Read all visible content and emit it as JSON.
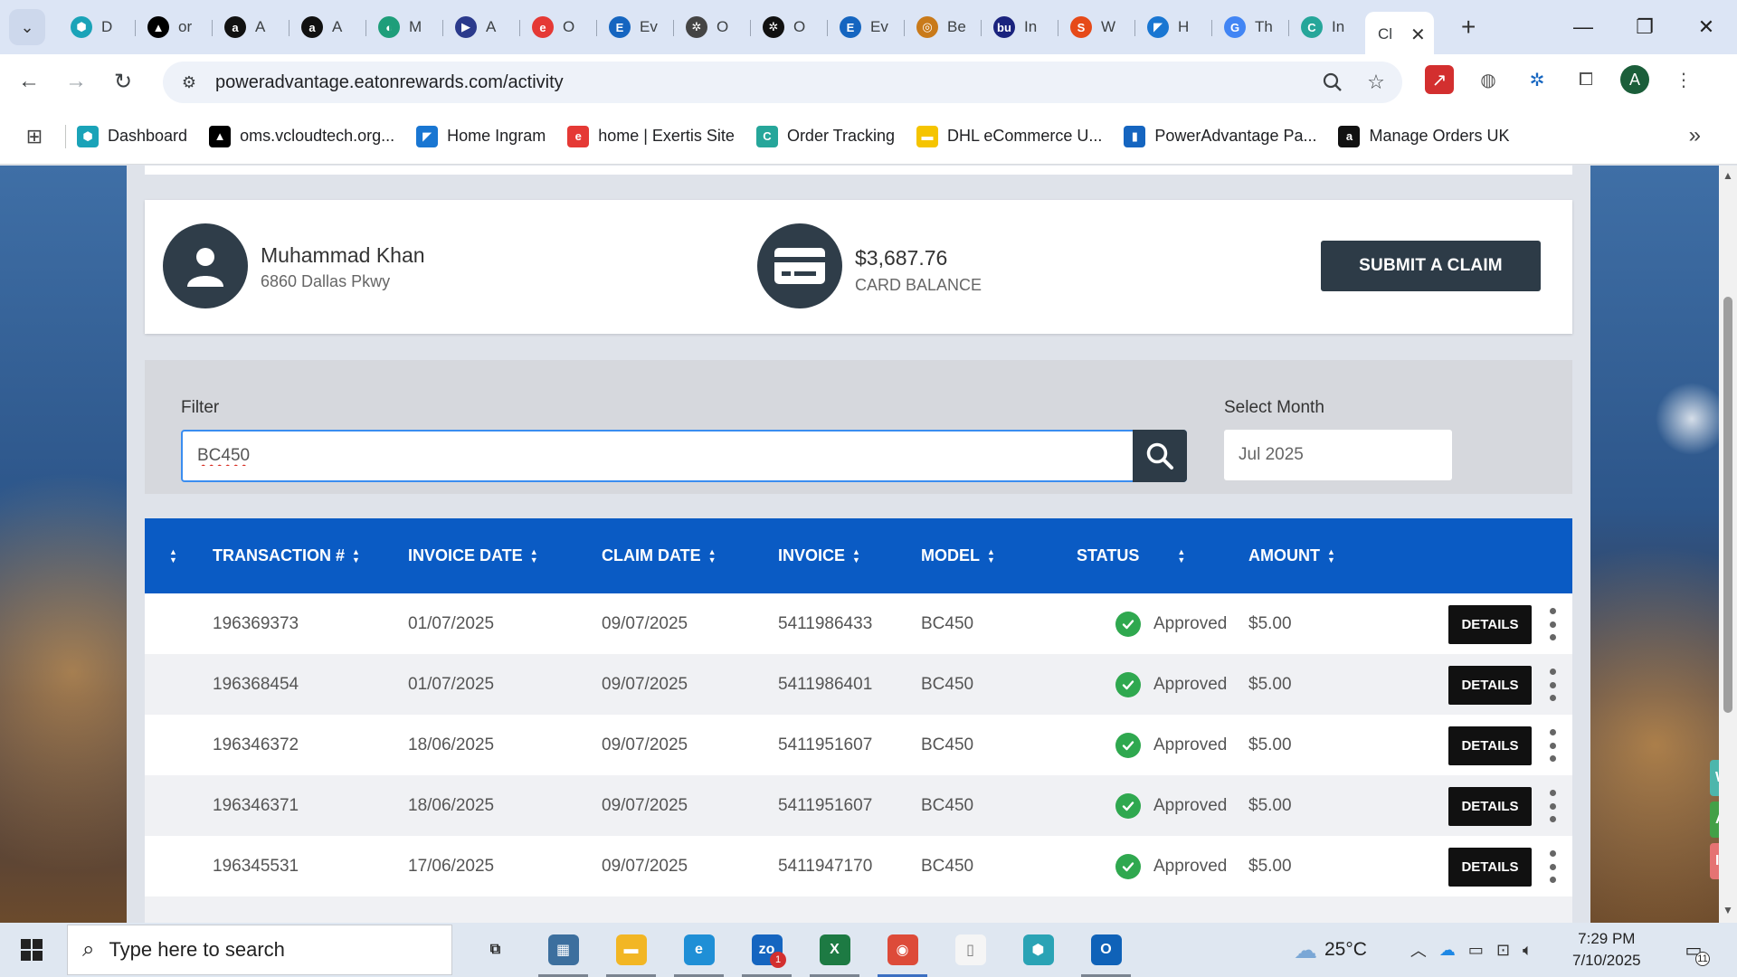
{
  "browser": {
    "tabs": [
      {
        "short": "D",
        "favicon": "hexagon-icon",
        "color": "#1aa3b8",
        "glyph": "⬢"
      },
      {
        "short": "or",
        "favicon": "triangle-icon",
        "color": "#000000",
        "glyph": "▲"
      },
      {
        "short": "A",
        "favicon": "amazon-icon",
        "color": "#111111",
        "glyph": "a"
      },
      {
        "short": "A",
        "favicon": "amazon-icon",
        "color": "#111111",
        "glyph": "a"
      },
      {
        "short": "M",
        "favicon": "leaf-icon",
        "color": "#1e9e7a",
        "glyph": "◐"
      },
      {
        "short": "A",
        "favicon": "arrow-icon",
        "color": "#2b3a8c",
        "glyph": "▶"
      },
      {
        "short": "O",
        "favicon": "exertis-icon",
        "color": "#e53935",
        "glyph": "e"
      },
      {
        "short": "Ev",
        "favicon": "e-icon",
        "color": "#1565c0",
        "glyph": "E"
      },
      {
        "short": "O",
        "favicon": "openai-icon",
        "color": "#444444",
        "glyph": "✲"
      },
      {
        "short": "O",
        "favicon": "openai-icon",
        "color": "#111111",
        "glyph": "✲"
      },
      {
        "short": "Ev",
        "favicon": "e-icon",
        "color": "#1565c0",
        "glyph": "E"
      },
      {
        "short": "Be",
        "favicon": "bulb-icon",
        "color": "#c97a1a",
        "glyph": "◎"
      },
      {
        "short": "In",
        "favicon": "bu-icon",
        "color": "#1a237e",
        "glyph": "bu"
      },
      {
        "short": "W",
        "favicon": "layers-icon",
        "color": "#e64a19",
        "glyph": "S"
      },
      {
        "short": "H",
        "favicon": "ingram-icon",
        "color": "#1976d2",
        "glyph": "◤"
      },
      {
        "short": "Th",
        "favicon": "google-icon",
        "color": "#4285f4",
        "glyph": "G"
      },
      {
        "short": "In",
        "favicon": "c-icon",
        "color": "#26a69a",
        "glyph": "C"
      }
    ],
    "active_tab_short": "Cl",
    "url": "poweradvantage.eatonrewards.com/activity",
    "bookmarks": [
      {
        "label": "Dashboard",
        "favicon": "hexagon-icon",
        "color": "#1aa3b8",
        "glyph": "⬢"
      },
      {
        "label": "oms.vcloudtech.org...",
        "favicon": "triangle-icon",
        "color": "#000000",
        "glyph": "▲"
      },
      {
        "label": "Home Ingram",
        "favicon": "ingram-icon",
        "color": "#1976d2",
        "glyph": "◤"
      },
      {
        "label": "home | Exertis Site",
        "favicon": "exertis-icon",
        "color": "#e53935",
        "glyph": "e"
      },
      {
        "label": "Order Tracking",
        "favicon": "c-icon",
        "color": "#26a69a",
        "glyph": "C"
      },
      {
        "label": "DHL eCommerce U...",
        "favicon": "dhl-icon",
        "color": "#f5c400",
        "glyph": "▬"
      },
      {
        "label": "PowerAdvantage Pa...",
        "favicon": "doc-icon",
        "color": "#1565c0",
        "glyph": "▮"
      },
      {
        "label": "Manage Orders UK",
        "favicon": "amazon-icon",
        "color": "#111111",
        "glyph": "a"
      }
    ],
    "profile_initial": "A"
  },
  "profile": {
    "name": "Muhammad Khan",
    "address": "6860 Dallas Pkwy",
    "balance": "$3,687.76",
    "balance_label": "CARD BALANCE",
    "submit_label": "SUBMIT A CLAIM"
  },
  "filter": {
    "label": "Filter",
    "value": "BC450",
    "month_label": "Select Month",
    "month_value": "Jul 2025"
  },
  "table": {
    "columns": [
      "TRANSACTION #",
      "INVOICE DATE",
      "CLAIM DATE",
      "INVOICE",
      "MODEL",
      "STATUS",
      "AMOUNT"
    ],
    "details_label": "DETAILS",
    "rows": [
      {
        "transaction": "196369373",
        "invoice_date": "01/07/2025",
        "claim_date": "09/07/2025",
        "invoice": "5411986433",
        "model": "BC450",
        "status": "Approved",
        "amount": "$5.00"
      },
      {
        "transaction": "196368454",
        "invoice_date": "01/07/2025",
        "claim_date": "09/07/2025",
        "invoice": "5411986401",
        "model": "BC450",
        "status": "Approved",
        "amount": "$5.00"
      },
      {
        "transaction": "196346372",
        "invoice_date": "18/06/2025",
        "claim_date": "09/07/2025",
        "invoice": "5411951607",
        "model": "BC450",
        "status": "Approved",
        "amount": "$5.00"
      },
      {
        "transaction": "196346371",
        "invoice_date": "18/06/2025",
        "claim_date": "09/07/2025",
        "invoice": "5411951607",
        "model": "BC450",
        "status": "Approved",
        "amount": "$5.00"
      },
      {
        "transaction": "196345531",
        "invoice_date": "17/06/2025",
        "claim_date": "09/07/2025",
        "invoice": "5411947170",
        "model": "BC450",
        "status": "Approved",
        "amount": "$5.00"
      }
    ]
  },
  "side_tabs": [
    {
      "letter": "W",
      "color": "#4db6ac"
    },
    {
      "letter": "A",
      "color": "#43a047"
    },
    {
      "letter": "In",
      "color": "#e57373"
    }
  ],
  "taskbar": {
    "search_placeholder": "Type here to search",
    "apps": [
      {
        "name": "task-view-icon",
        "glyph": "⧉",
        "color": "transparent",
        "fg": "#222",
        "state": ""
      },
      {
        "name": "calculator-icon",
        "glyph": "▦",
        "color": "#3c6f9e",
        "fg": "#fff",
        "state": "open"
      },
      {
        "name": "file-explorer-icon",
        "glyph": "▬",
        "color": "#f2b624",
        "fg": "#fff",
        "state": "open"
      },
      {
        "name": "edge-icon",
        "glyph": "e",
        "color": "#1f8fd6",
        "fg": "#fff",
        "state": "open"
      },
      {
        "name": "zoho-icon",
        "glyph": "zo",
        "color": "#1565c0",
        "fg": "#fff",
        "state": "open",
        "badge": "1"
      },
      {
        "name": "excel-icon",
        "glyph": "X",
        "color": "#1d7a43",
        "fg": "#fff",
        "state": "open"
      },
      {
        "name": "chrome-icon",
        "glyph": "◉",
        "color": "#dd4b39",
        "fg": "#fff",
        "state": "open active"
      },
      {
        "name": "notepad-icon",
        "glyph": "▯",
        "color": "#f5f5f5",
        "fg": "#777",
        "state": ""
      },
      {
        "name": "gem-app-icon",
        "glyph": "⬢",
        "color": "#2aa3b5",
        "fg": "#fff",
        "state": ""
      },
      {
        "name": "outlook-icon",
        "glyph": "O",
        "color": "#0f62b8",
        "fg": "#fff",
        "state": "open"
      }
    ],
    "temperature": "25°C",
    "time": "7:29 PM",
    "date": "7/10/2025",
    "notification_count": "11"
  }
}
